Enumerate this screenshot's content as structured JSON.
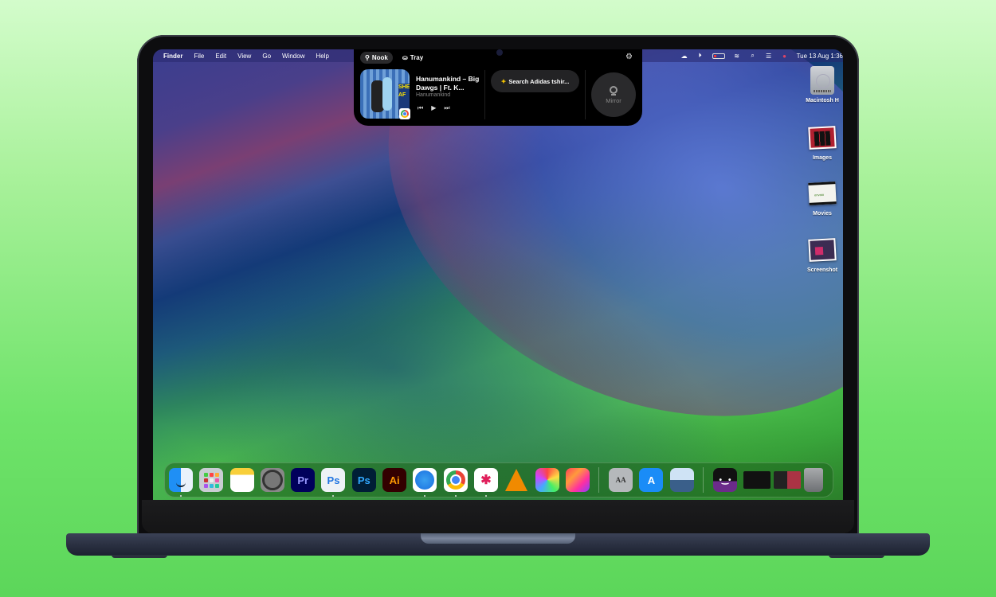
{
  "menubar": {
    "app_name": "Finder",
    "menus": [
      "File",
      "Edit",
      "View",
      "Go",
      "Window",
      "Help"
    ],
    "status_icons": [
      "creative-cloud-icon",
      "play-circle-icon",
      "battery-icon",
      "wifi-icon",
      "search-icon",
      "control-center-icon",
      "siri-icon"
    ],
    "clock": "Tue 13 Aug  1:36"
  },
  "nook": {
    "tabs": [
      {
        "label": "Nook",
        "icon": "nook-lamp-icon",
        "active": true
      },
      {
        "label": "Tray",
        "icon": "tray-icon",
        "active": false
      }
    ],
    "settings_icon": "gear-icon",
    "now_playing": {
      "title": "Hanumankind – Big Dawgs | Ft. K...",
      "artist": "Hanumankind",
      "art_text": "SHE AF",
      "source_badge": "chrome-icon",
      "controls": [
        "⏮",
        "▶",
        "⏭"
      ]
    },
    "search_pill": {
      "label": "Search Adidas tshir...",
      "icon": "sparkle-icon"
    },
    "mirror": {
      "label": "Mirror",
      "icon": "webcam-icon"
    }
  },
  "desktop_icons": [
    {
      "label": "Macintosh H",
      "icon": "hard-drive-icon"
    },
    {
      "label": "Images",
      "icon": "folder-images-icon"
    },
    {
      "label": "Movies",
      "icon": "folder-movies-icon"
    },
    {
      "label": "Screenshot",
      "icon": "folder-screenshots-icon"
    }
  ],
  "dock": {
    "apps": [
      {
        "name": "Finder",
        "running": true
      },
      {
        "name": "Launchpad",
        "running": false
      },
      {
        "name": "Notes",
        "running": false
      },
      {
        "name": "System Settings",
        "running": false
      },
      {
        "name": "Premiere Pro",
        "text": "Pr",
        "running": false
      },
      {
        "name": "Photoshop Beta",
        "text": "Ps",
        "running": true
      },
      {
        "name": "Photoshop",
        "text": "Ps",
        "running": false
      },
      {
        "name": "Illustrator",
        "text": "Ai",
        "running": false
      },
      {
        "name": "Safari",
        "running": true
      },
      {
        "name": "Google Chrome",
        "running": true
      },
      {
        "name": "Slack",
        "text": "✱",
        "running": true
      },
      {
        "name": "VLC",
        "running": false
      },
      {
        "name": "Final Cut Pro",
        "running": false
      },
      {
        "name": "Creative Cloud",
        "running": false
      },
      {
        "name": "Font Book",
        "text": "AA",
        "running": false
      },
      {
        "name": "App Store",
        "text": "A",
        "running": false
      },
      {
        "name": "Preview",
        "running": false
      }
    ],
    "recents": [
      {
        "name": "Face App",
        "text": "•‿•"
      },
      {
        "name": "Slack window"
      },
      {
        "name": "Chrome window"
      },
      {
        "name": "Trash"
      }
    ]
  }
}
